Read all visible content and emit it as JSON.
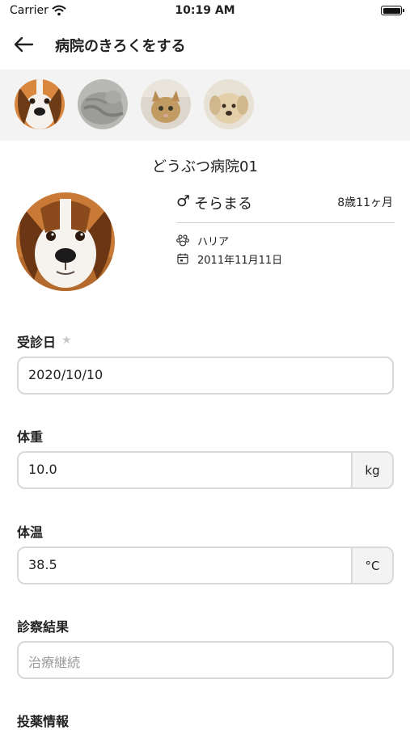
{
  "status_bar": {
    "carrier": "Carrier",
    "time": "10:19 AM"
  },
  "header": {
    "title": "病院のきろくをする",
    "back_icon": "arrow-left-icon"
  },
  "pet_strip": {
    "pets": [
      {
        "name": "beagle-photo",
        "selected": true
      },
      {
        "name": "gray-cat-photo",
        "selected": false
      },
      {
        "name": "tabby-kitten-photo",
        "selected": false
      },
      {
        "name": "puppy-photo",
        "selected": false
      }
    ]
  },
  "hospital": {
    "name": "どうぶつ病院01"
  },
  "pet": {
    "gender_symbol": "♂",
    "name": "そらまる",
    "age": "8歳11ヶ月",
    "breed": "ハリア",
    "birthday": "2011年11月11日"
  },
  "form": {
    "visit_date": {
      "label": "受診日",
      "required_symbol": "★",
      "value": "2020/10/10"
    },
    "weight": {
      "label": "体重",
      "value": "10.0",
      "unit": "kg"
    },
    "temperature": {
      "label": "体温",
      "value": "38.5",
      "unit": "°C"
    },
    "diagnosis": {
      "label": "診察結果",
      "placeholder": "治療継続"
    },
    "medication": {
      "label": "投薬情報"
    }
  },
  "colors": {
    "strip_background": "#f3f3f3",
    "input_border": "#d9d9d9",
    "placeholder_text": "#9a9a9a"
  }
}
